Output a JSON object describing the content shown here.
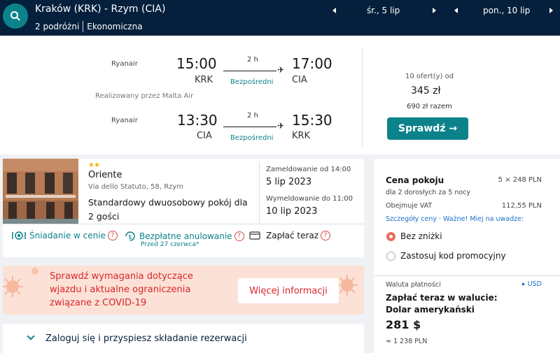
{
  "header": {
    "route": "Kraków (KRK) - Rzym (CIA)",
    "travelers": "2 podróżni",
    "cabin": "Ekonomiczna",
    "depart_date": "śr., 5 lip",
    "return_date": "pon., 10 lip"
  },
  "flight": {
    "outbound": {
      "carrier": "Ryanair",
      "dep_time": "15:00",
      "arr_time": "17:00",
      "dep_code": "KRK",
      "arr_code": "CIA",
      "duration": "2 h",
      "stops": "Bezpośredni"
    },
    "operated_by": "Realizowany przez Malta Air",
    "inbound": {
      "carrier": "Ryanair",
      "dep_time": "13:30",
      "arr_time": "15:30",
      "dep_code": "CIA",
      "arr_code": "KRK",
      "duration": "2 h",
      "stops": "Bezpośredni"
    },
    "offers": "10 ofert(y) od",
    "price": "345 zł",
    "total": "690 zł razem",
    "check_label": "Sprawdź →"
  },
  "hotel": {
    "stars": "★★",
    "name": "Oriente",
    "address": "Via dello Statuto, 58, Rzym",
    "room": "Standardowy dwuosobowy pokój dla 2 gości",
    "checkin_label": "Zameldowanie od 14:00",
    "checkin_date": "5 lip 2023",
    "checkout_label": "Wymeldowanie do 11:00",
    "checkout_date": "10 lip 2023",
    "amenities": {
      "breakfast": "Śniadanie w cenie",
      "cancel": "Bezpłatne anulowanie",
      "cancel_sub": "Przed 27 czerwca*",
      "pay": "Zapłać teraz"
    }
  },
  "covid": {
    "text": "Sprawdź wymagania dotyczące wjazdu i aktualne ograniczenia związane z COVID-19",
    "button": "Więcej informacji"
  },
  "login": {
    "text": "Zaloguj się i przyspiesz składanie rezerwacji"
  },
  "panel": {
    "title": "Cena pokoju",
    "room_price": "5 × 248 PLN",
    "guests": "dla 2 dorosłych  za 5 nocy",
    "vat_label": "Obejmuje VAT",
    "vat_value": "112,55 PLN",
    "details_link": "Szczegóły ceny · Ważne! Miej na uwadze:",
    "option_1": "Bez zniżki",
    "option_2": "Zastosuj kod promocyjny",
    "currency_label": "Waluta płatności",
    "currency_code": "▸ USD",
    "pay_line_1": "Zapłać teraz w walucie:",
    "pay_line_2": "Dolar amerykański",
    "price_usd": "281 $",
    "price_pln": "≈ 1 238 PLN"
  },
  "colors": {
    "header_bg": "#05203c",
    "accent": "#0c838a",
    "covid_bg": "#fce1d6",
    "covid_text": "#d8262b"
  },
  "icons": [
    "search-icon",
    "arrow-left-icon",
    "arrow-right-icon",
    "plane-icon",
    "star-icon",
    "breakfast-icon",
    "cancel-icon",
    "card-icon",
    "question-icon",
    "virus-icon",
    "chevron-down-icon"
  ]
}
